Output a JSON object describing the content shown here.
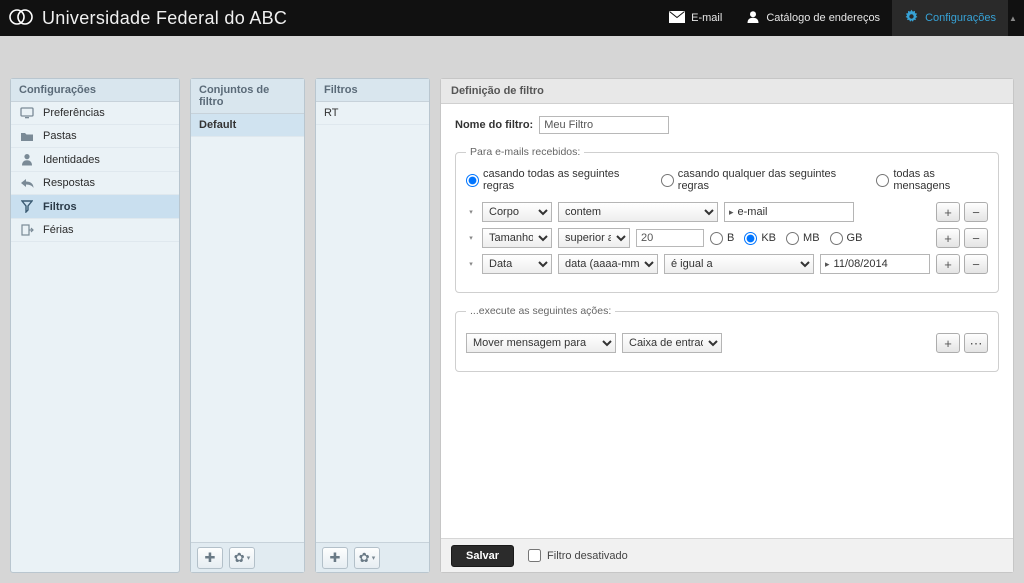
{
  "brand": "Universidade Federal do ABC",
  "topnav": {
    "email": "E-mail",
    "contacts": "Catálogo de endereços",
    "settings": "Configurações"
  },
  "settings_panel": {
    "title": "Configurações",
    "items": [
      {
        "label": "Preferências",
        "icon": "monitor"
      },
      {
        "label": "Pastas",
        "icon": "folder"
      },
      {
        "label": "Identidades",
        "icon": "person"
      },
      {
        "label": "Respostas",
        "icon": "reply"
      },
      {
        "label": "Filtros",
        "icon": "filter",
        "selected": true
      },
      {
        "label": "Férias",
        "icon": "exit"
      }
    ]
  },
  "sets_panel": {
    "title": "Conjuntos de filtro",
    "items": [
      {
        "label": "Default",
        "selected": true
      }
    ]
  },
  "filters_panel": {
    "title": "Filtros",
    "items": [
      {
        "label": "RT"
      }
    ]
  },
  "def_panel": {
    "title": "Definição de filtro",
    "name_label": "Nome do filtro:",
    "name_value": "Meu Filtro",
    "rules_legend": "Para e-mails recebidos:",
    "match_modes": {
      "all": "casando todas as seguintes regras",
      "any": "casando qualquer das seguintes regras",
      "every": "todas as mensagens"
    },
    "rules": [
      {
        "field": "Corpo",
        "op": "contem",
        "value": "e-mail",
        "kind": "text"
      },
      {
        "field": "Tamanho",
        "op": "superior a",
        "value": "20",
        "kind": "size",
        "units": {
          "B": "B",
          "KB": "KB",
          "MB": "MB",
          "GB": "GB"
        },
        "unit_selected": "KB"
      },
      {
        "field": "Data",
        "op1": "data (aaaa-mm-dd)",
        "op2": "é igual a",
        "value": "11/08/2014",
        "kind": "date"
      }
    ],
    "actions_legend": "...execute as seguintes ações:",
    "actions": [
      {
        "action": "Mover mensagem para",
        "target": "Caixa de entrada"
      }
    ],
    "save": "Salvar",
    "disabled_label": "Filtro desativado"
  },
  "glyph": {
    "plus": "+",
    "minus": "−",
    "dots": "⋯"
  }
}
